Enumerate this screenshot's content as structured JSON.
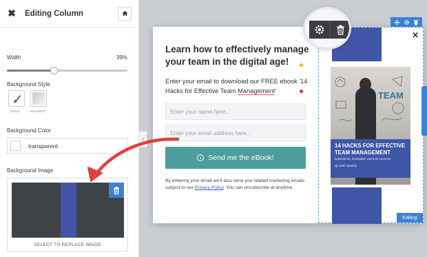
{
  "panel": {
    "title": "Editing Column",
    "width_label": "Width",
    "width_value": "39%",
    "width_fraction": 0.39,
    "background_style_label": "Background Style",
    "style_options": [
      "SOLID",
      "GRADIENT"
    ],
    "background_color_label": "Background Color",
    "background_color_value": "transparent",
    "background_image_label": "Background Image",
    "replace_image_label": "SELECT TO REPLACE IMAGE"
  },
  "popup": {
    "headline": "Learn how to effectively manage your team in the digital age!",
    "subtext_before": "Enter your email to download our FREE ebook '14 Hacks for Effective Team ",
    "subtext_underlined": "Management",
    "subtext_after": "'",
    "name_placeholder": "Enter your name here...",
    "email_placeholder": "Enter your email address here...",
    "cta_label": "Send me the eBook!",
    "disclaimer_before": "By entering your email we'll also send you related marketing emails subject to our ",
    "disclaimer_link": "Privacy Policy",
    "disclaimer_after": ". You can unsubscribe at anytime.",
    "editing_badge": "Editing"
  },
  "book": {
    "title": "14 HACKS FOR EFFECTIVE TEAM MANAGEMENT",
    "subtitle": "Experience, Examples, and Life Lessons",
    "author": "By Seth Stanley",
    "wall_word": "TEAM"
  },
  "colors": {
    "accent_blue": "#3b82d4",
    "cta_teal": "#4b9e9c",
    "stripe_blue": "#4155a6",
    "arrow_red": "#e0403a"
  }
}
